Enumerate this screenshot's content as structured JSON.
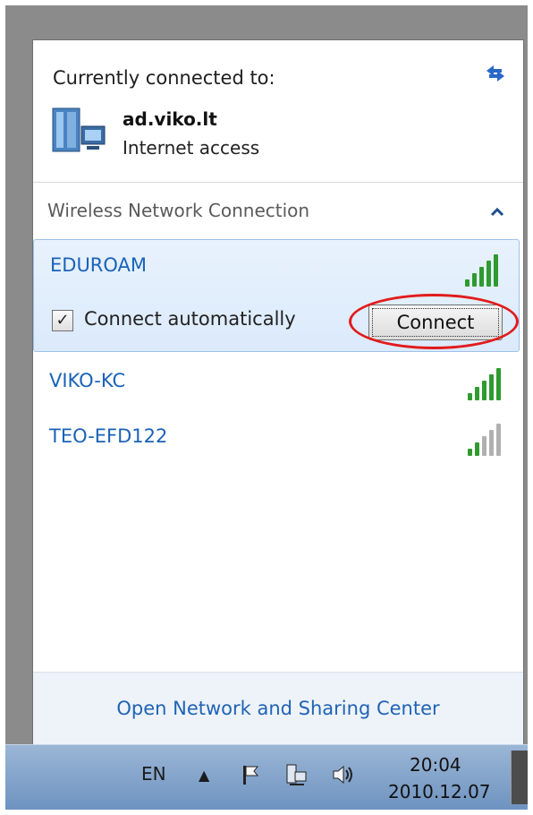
{
  "header": {
    "title": "Currently connected to:"
  },
  "current": {
    "name": "ad.viko.lt",
    "status": "Internet access"
  },
  "section": {
    "title": "Wireless Network Connection"
  },
  "networks": [
    {
      "name": "EDUROAM",
      "signal": 5,
      "selected": true
    },
    {
      "name": "VIKO-KC",
      "signal": 5,
      "selected": false
    },
    {
      "name": "TEO-EFD122",
      "signal": 2,
      "selected": false
    }
  ],
  "selected_controls": {
    "auto_label": "Connect automatically",
    "auto_checked": true,
    "checkbox_mark": "✓",
    "connect_label": "Connect"
  },
  "footer": {
    "link": "Open Network and Sharing Center"
  },
  "taskbar": {
    "lang": "EN",
    "arrow": "▲",
    "time": "20:04",
    "date": "2010.12.07"
  },
  "colors": {
    "link": "#1f63b5",
    "highlight": "#dbeafb",
    "annotation": "#e21b1b",
    "signal_on": "#2f9a2f",
    "signal_off": "#b0b0b0"
  }
}
